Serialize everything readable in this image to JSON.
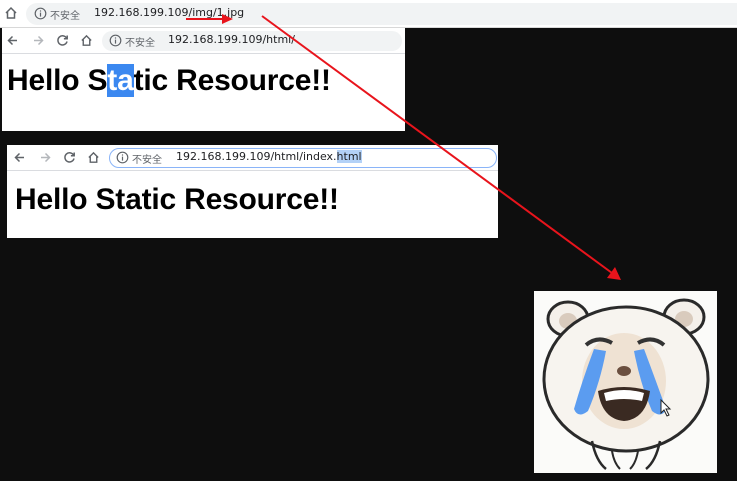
{
  "top_bar": {
    "insecure_label": "不安全",
    "url_host": "192.168.199.109",
    "url_path": "/img/1.jpg"
  },
  "window1": {
    "insecure_label": "不安全",
    "url": "192.168.199.109/html/",
    "heading_before": "Hello S",
    "heading_selected": "ta",
    "heading_after": "tic Resource!!"
  },
  "window2": {
    "insecure_label": "不安全",
    "url_prefix": "192.168.199.109/html/index.",
    "url_selected": "html",
    "heading": "Hello Static Resource!!"
  },
  "colors": {
    "background": "#0e0e0e",
    "arrow": "#e8141c",
    "selection": "#3b88f0",
    "tears": "#5b9cf0"
  }
}
